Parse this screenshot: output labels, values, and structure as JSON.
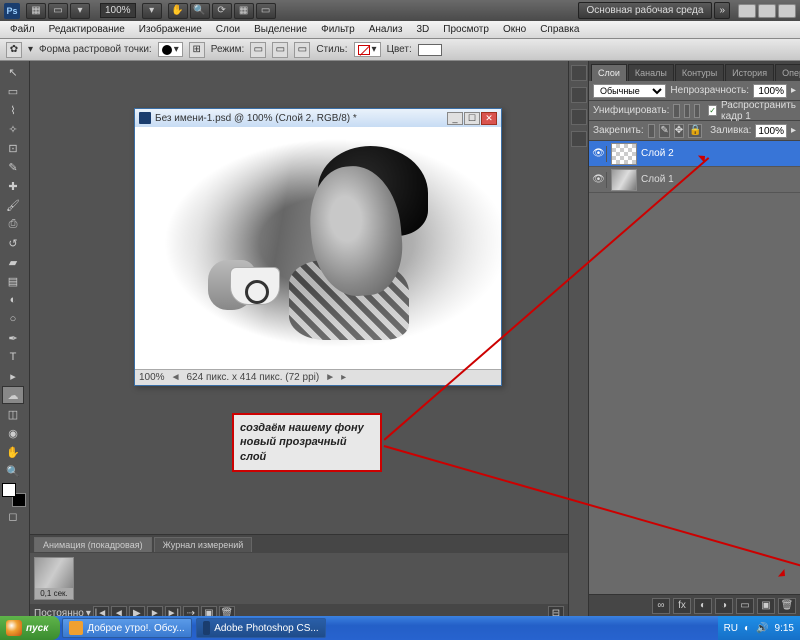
{
  "topbar": {
    "zoom": "100%",
    "workspace": "Основная рабочая среда",
    "chev": "»"
  },
  "menu": [
    "Файл",
    "Редактирование",
    "Изображение",
    "Слои",
    "Выделение",
    "Фильтр",
    "Анализ",
    "3D",
    "Просмотр",
    "Окно",
    "Справка"
  ],
  "options": {
    "brush_label": "Форма растровой точки:",
    "mode_label": "Режим:",
    "style_label": "Стиль:",
    "color_label": "Цвет:"
  },
  "doc": {
    "title": "Без имени-1.psd @ 100% (Слой 2, RGB/8) *",
    "zoom": "100%",
    "info": "624 пикс. x 414 пикс. (72 ppi)"
  },
  "callout": "создаём нашему фону  новый прозрачный слой",
  "animation": {
    "tab1": "Анимация (покадровая)",
    "tab2": "Журнал измерений",
    "frame_time": "0,1 сек.",
    "loop": "Постоянно"
  },
  "layers_panel": {
    "tabs": [
      "Слои",
      "Каналы",
      "Контуры",
      "История",
      "Операции"
    ],
    "blend": "Обычные",
    "opacity_label": "Непрозрачность:",
    "opacity": "100%",
    "unify_label": "Унифицировать:",
    "propagate": "Распространить кадр 1",
    "lock_label": "Закрепить:",
    "fill_label": "Заливка:",
    "fill": "100%",
    "layers": [
      {
        "name": "Слой 2",
        "selected": true,
        "thumb": "trans"
      },
      {
        "name": "Слой 1",
        "selected": false,
        "thumb": "img"
      }
    ]
  },
  "taskbar": {
    "start": "пуск",
    "tasks": [
      {
        "label": "Доброе утро!. Обсу...",
        "active": false,
        "color": "#f0a030"
      },
      {
        "label": "Adobe Photoshop CS...",
        "active": true,
        "color": "#1a3d6e"
      }
    ],
    "lang": "RU",
    "time": "9:15"
  }
}
